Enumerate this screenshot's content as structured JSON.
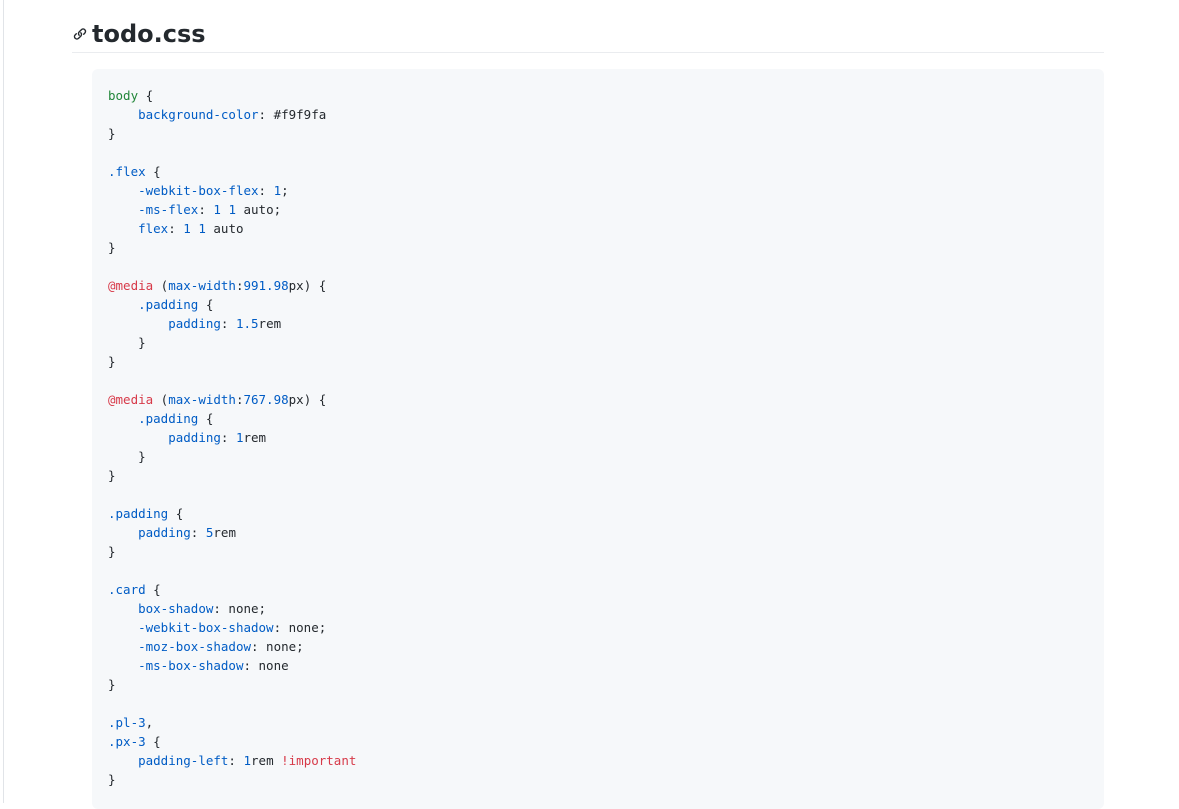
{
  "heading": {
    "title": "todo.css"
  },
  "code_lines": [
    [
      [
        "sel",
        "body"
      ],
      [
        "p",
        " {"
      ]
    ],
    [
      [
        "p",
        "    "
      ],
      [
        "prop",
        "background-color"
      ],
      [
        "p",
        ": #f9f9fa"
      ]
    ],
    [
      [
        "p",
        "}"
      ]
    ],
    [
      [
        "p",
        ""
      ]
    ],
    [
      [
        "cls",
        ".flex"
      ],
      [
        "p",
        " {"
      ]
    ],
    [
      [
        "p",
        "    "
      ],
      [
        "prop",
        "-webkit-box-flex"
      ],
      [
        "p",
        ": "
      ],
      [
        "num",
        "1"
      ],
      [
        "p",
        ";"
      ]
    ],
    [
      [
        "p",
        "    "
      ],
      [
        "prop",
        "-ms-flex"
      ],
      [
        "p",
        ": "
      ],
      [
        "num",
        "1"
      ],
      [
        "p",
        " "
      ],
      [
        "num",
        "1"
      ],
      [
        "p",
        " auto;"
      ]
    ],
    [
      [
        "p",
        "    "
      ],
      [
        "prop",
        "flex"
      ],
      [
        "p",
        ": "
      ],
      [
        "num",
        "1"
      ],
      [
        "p",
        " "
      ],
      [
        "num",
        "1"
      ],
      [
        "p",
        " auto"
      ]
    ],
    [
      [
        "p",
        "}"
      ]
    ],
    [
      [
        "p",
        ""
      ]
    ],
    [
      [
        "at",
        "@media"
      ],
      [
        "p",
        " ("
      ],
      [
        "prop",
        "max-width"
      ],
      [
        "p",
        ":"
      ],
      [
        "num",
        "991.98"
      ],
      [
        "p",
        "px) {"
      ]
    ],
    [
      [
        "p",
        "    "
      ],
      [
        "cls",
        ".padding"
      ],
      [
        "p",
        " {"
      ]
    ],
    [
      [
        "p",
        "        "
      ],
      [
        "prop",
        "padding"
      ],
      [
        "p",
        ": "
      ],
      [
        "num",
        "1.5"
      ],
      [
        "p",
        "rem"
      ]
    ],
    [
      [
        "p",
        "    }"
      ]
    ],
    [
      [
        "p",
        "}"
      ]
    ],
    [
      [
        "p",
        ""
      ]
    ],
    [
      [
        "at",
        "@media"
      ],
      [
        "p",
        " ("
      ],
      [
        "prop",
        "max-width"
      ],
      [
        "p",
        ":"
      ],
      [
        "num",
        "767.98"
      ],
      [
        "p",
        "px) {"
      ]
    ],
    [
      [
        "p",
        "    "
      ],
      [
        "cls",
        ".padding"
      ],
      [
        "p",
        " {"
      ]
    ],
    [
      [
        "p",
        "        "
      ],
      [
        "prop",
        "padding"
      ],
      [
        "p",
        ": "
      ],
      [
        "num",
        "1"
      ],
      [
        "p",
        "rem"
      ]
    ],
    [
      [
        "p",
        "    }"
      ]
    ],
    [
      [
        "p",
        "}"
      ]
    ],
    [
      [
        "p",
        ""
      ]
    ],
    [
      [
        "cls",
        ".padding"
      ],
      [
        "p",
        " {"
      ]
    ],
    [
      [
        "p",
        "    "
      ],
      [
        "prop",
        "padding"
      ],
      [
        "p",
        ": "
      ],
      [
        "num",
        "5"
      ],
      [
        "p",
        "rem"
      ]
    ],
    [
      [
        "p",
        "}"
      ]
    ],
    [
      [
        "p",
        ""
      ]
    ],
    [
      [
        "cls",
        ".card"
      ],
      [
        "p",
        " {"
      ]
    ],
    [
      [
        "p",
        "    "
      ],
      [
        "prop",
        "box-shadow"
      ],
      [
        "p",
        ": none;"
      ]
    ],
    [
      [
        "p",
        "    "
      ],
      [
        "prop",
        "-webkit-box-shadow"
      ],
      [
        "p",
        ": none;"
      ]
    ],
    [
      [
        "p",
        "    "
      ],
      [
        "prop",
        "-moz-box-shadow"
      ],
      [
        "p",
        ": none;"
      ]
    ],
    [
      [
        "p",
        "    "
      ],
      [
        "prop",
        "-ms-box-shadow"
      ],
      [
        "p",
        ": none"
      ]
    ],
    [
      [
        "p",
        "}"
      ]
    ],
    [
      [
        "p",
        ""
      ]
    ],
    [
      [
        "cls",
        ".pl-3"
      ],
      [
        "p",
        ","
      ]
    ],
    [
      [
        "cls",
        ".px-3"
      ],
      [
        "p",
        " {"
      ]
    ],
    [
      [
        "p",
        "    "
      ],
      [
        "prop",
        "padding-left"
      ],
      [
        "p",
        ": "
      ],
      [
        "num",
        "1"
      ],
      [
        "p",
        "rem "
      ],
      [
        "imp",
        "!important"
      ]
    ],
    [
      [
        "p",
        "}"
      ]
    ]
  ],
  "colors": {
    "selector": "#22863a",
    "property": "#005cc5",
    "at_rule": "#d73a49",
    "code_bg": "#f6f8fa"
  },
  "icons": {
    "heading_link": "link-icon"
  }
}
